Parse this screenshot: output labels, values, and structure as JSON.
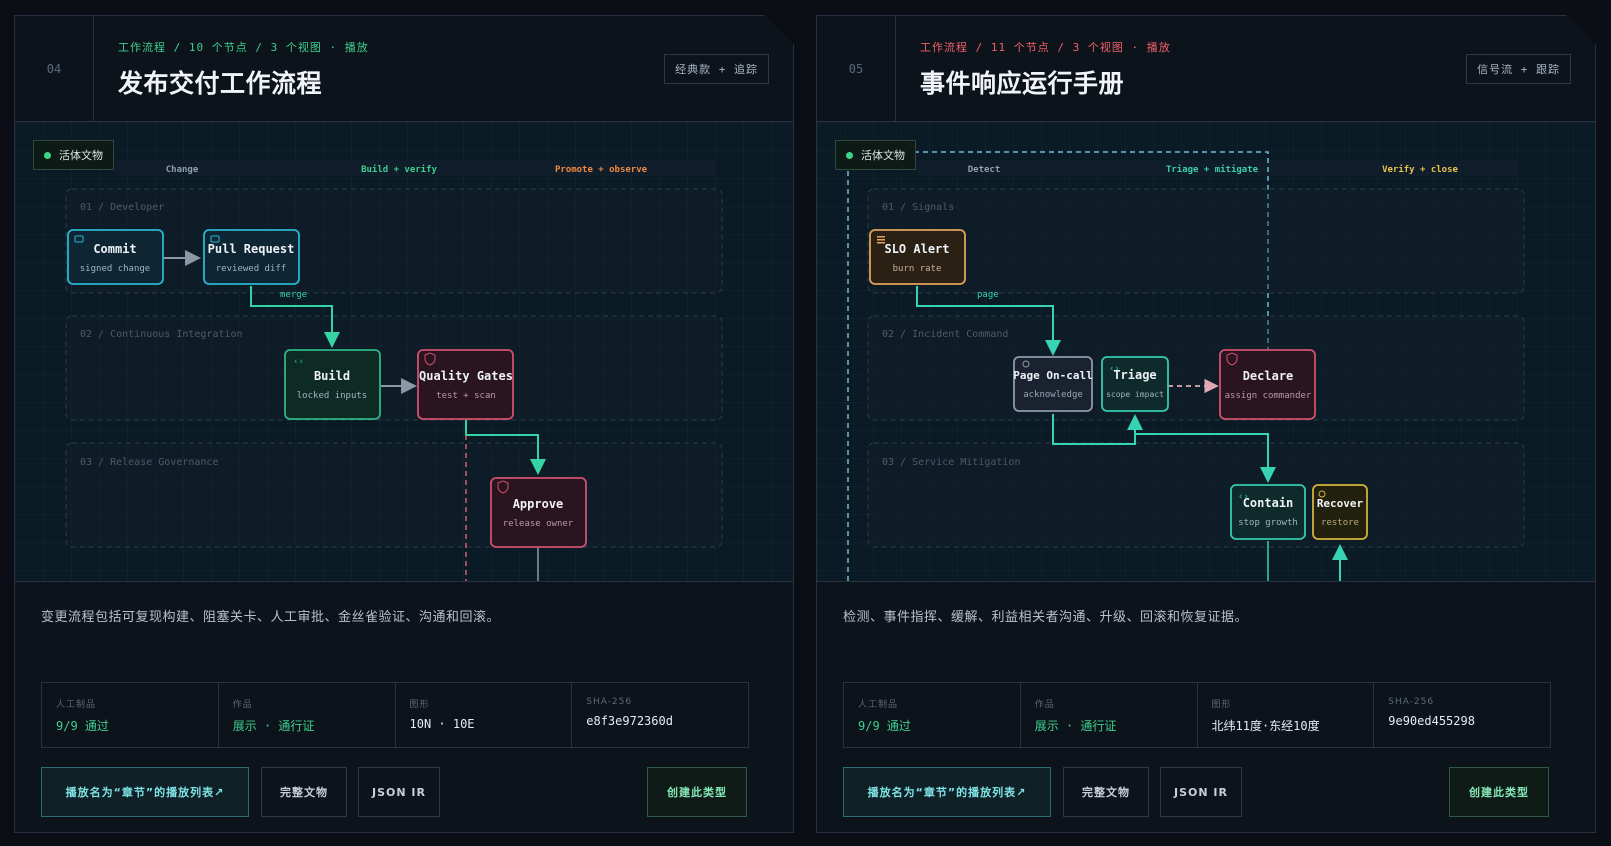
{
  "cards": [
    {
      "num": "04",
      "kicker": "工作流程 / 10 个节点 / 3 个视图 · 播放",
      "kicker_color": "#3ecf8e",
      "title": "发布交付工作流程",
      "mode": "经典款 + 追踪",
      "live": "活体文物",
      "phases": [
        "Change",
        "Build + verify",
        "Promote + observe"
      ],
      "phase_colors": [
        "#8fa0b3",
        "#3ecf8e",
        "#f0883e"
      ],
      "lanes": [
        "01 / Developer",
        "02 / Continuous Integration",
        "03 / Release Governance"
      ],
      "nodes": [
        {
          "title": "Commit",
          "sub": "signed change",
          "style": "cyan",
          "icon": "window-icon"
        },
        {
          "title": "Pull Request",
          "sub": "reviewed diff",
          "style": "cyan",
          "icon": "window-icon"
        },
        {
          "title": "Build",
          "sub": "locked inputs",
          "style": "green",
          "icon": "code-icon"
        },
        {
          "title": "Quality Gates",
          "sub": "test + scan",
          "style": "red",
          "icon": "shield-icon"
        },
        {
          "title": "Approve",
          "sub": "release owner",
          "style": "red",
          "icon": "shield-icon"
        }
      ],
      "edge_labels": [
        "merge"
      ],
      "description": "变更流程包括可复现构建、阻塞关卡、人工审批、金丝雀验证、沟通和回滚。",
      "stats": [
        {
          "label": "人工制品",
          "value": "9/9 通过",
          "color": "#3ecf8e"
        },
        {
          "label": "作品",
          "value": "展示 · 通行证",
          "color": "#3ecf8e"
        },
        {
          "label": "图形",
          "value": "10N · 10E",
          "color": "#e6ecf2"
        },
        {
          "label": "SHA-256",
          "value": "e8f3e972360d",
          "color": "#e6ecf2"
        }
      ],
      "buttons": {
        "play": "播放名为“章节”的播放列表↗",
        "full": "完整文物",
        "json": "JSON IR",
        "create": "创建此类型"
      }
    },
    {
      "num": "05",
      "kicker": "工作流程 / 11 个节点 / 3 个视图 · 播放",
      "kicker_color": "#f0606a",
      "title": "事件响应运行手册",
      "mode": "信号流 + 跟踪",
      "live": "活体文物",
      "phases": [
        "Detect",
        "Triage + mitigate",
        "Verify + close"
      ],
      "phase_colors": [
        "#8fa0b3",
        "#3ecfa8",
        "#e8c44a"
      ],
      "lanes": [
        "01 / Signals",
        "02 / Incident Command",
        "03 / Service Mitigation"
      ],
      "nodes": [
        {
          "title": "SLO Alert",
          "sub": "burn rate",
          "style": "orange",
          "icon": "bars-icon"
        },
        {
          "title": "Page On-call",
          "sub": "acknowledge",
          "style": "gray",
          "icon": "bell-icon"
        },
        {
          "title": "Triage",
          "sub": "scope impact",
          "style": "teal",
          "icon": "code-icon"
        },
        {
          "title": "Declare",
          "sub": "assign commander",
          "style": "red",
          "icon": "shield-icon"
        },
        {
          "title": "Contain",
          "sub": "stop growth",
          "style": "teal",
          "icon": "code-icon"
        },
        {
          "title": "Recover",
          "sub": "restore",
          "style": "yellow",
          "icon": "circle-icon"
        }
      ],
      "edge_labels": [
        "page"
      ],
      "description": "检测、事件指挥、缓解、利益相关者沟通、升级、回滚和恢复证据。",
      "stats": [
        {
          "label": "人工制品",
          "value": "9/9 通过",
          "color": "#3ecf8e"
        },
        {
          "label": "作品",
          "value": "展示 · 通行证",
          "color": "#3ecf8e"
        },
        {
          "label": "图形",
          "value": "北纬11度·东经10度",
          "color": "#e6ecf2"
        },
        {
          "label": "SHA-256",
          "value": "9e90ed455298",
          "color": "#e6ecf2"
        }
      ],
      "buttons": {
        "play": "播放名为“章节”的播放列表↗",
        "full": "完整文物",
        "json": "JSON IR",
        "create": "创建此类型"
      }
    }
  ]
}
